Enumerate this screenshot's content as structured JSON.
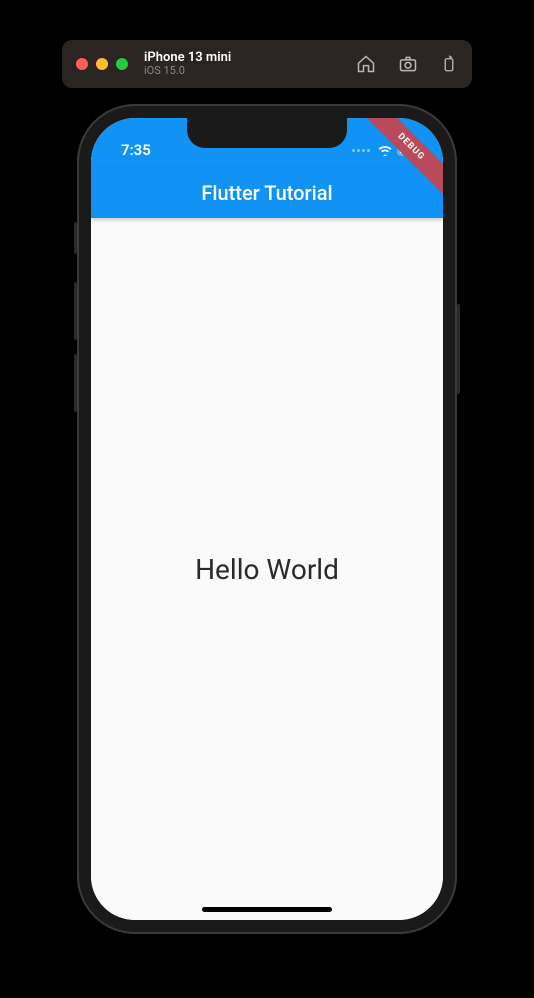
{
  "simulator": {
    "device_name": "iPhone 13 mini",
    "os_version": "iOS 15.0"
  },
  "status_bar": {
    "time": "7:35"
  },
  "app": {
    "app_bar_title": "Flutter Tutorial",
    "body_text": "Hello World",
    "debug_label": "DEBUG"
  },
  "colors": {
    "primary": "#1093f5",
    "scaffold_bg": "#fafafa"
  }
}
